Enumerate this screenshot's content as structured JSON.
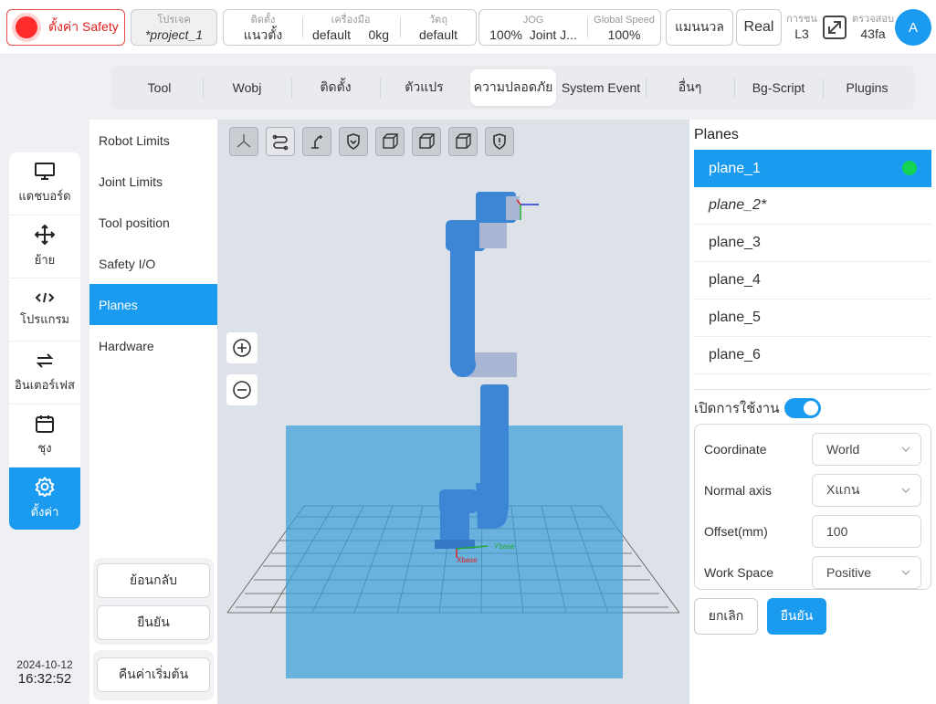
{
  "topbar": {
    "safety_label": "ตั้งค่า Safety",
    "project": {
      "label": "โปรเจค",
      "value": "*project_1"
    },
    "install": {
      "label": "ติดตั้ง",
      "value": "แนวตั้ง",
      "tool_label": "เครื่องมือ",
      "tool_value": "default",
      "weight_value": "0kg",
      "object_label": "วัตถุ",
      "object_value": "default"
    },
    "jog": {
      "label": "JOG",
      "value": "100%",
      "joint_value": "Joint J...",
      "speed_label": "Global Speed",
      "speed_value": "100%"
    },
    "manual_label": "แมนนวล",
    "real_label": "Real",
    "collision": {
      "label": "การชน",
      "value": "L3"
    },
    "check": {
      "label": "ตรวจสอบ",
      "value": "43fa"
    },
    "avatar_letter": "A"
  },
  "leftnav": {
    "items": [
      {
        "label": "แดชบอร์ด",
        "icon": "monitor-icon"
      },
      {
        "label": "ย้าย",
        "icon": "move-icon"
      },
      {
        "label": "โปรแกรม",
        "icon": "code-icon"
      },
      {
        "label": "อินเตอร์เฟส",
        "icon": "interface-icon"
      },
      {
        "label": "ชุง",
        "icon": "calendar-icon"
      },
      {
        "label": "ตั้งค่า",
        "icon": "gear-icon"
      }
    ],
    "date": "2024-10-12",
    "time": "16:32:52"
  },
  "tabs": [
    {
      "label": "Tool"
    },
    {
      "label": "Wobj"
    },
    {
      "label": "ติดตั้ง"
    },
    {
      "label": "ตัวแปร"
    },
    {
      "label": "ความปลอดภัย"
    },
    {
      "label": "System Event"
    },
    {
      "label": "อื่นๆ"
    },
    {
      "label": "Bg-Script"
    },
    {
      "label": "Plugins"
    }
  ],
  "active_tab": "ความปลอดภัย",
  "submenu": {
    "items": [
      {
        "label": "Robot Limits"
      },
      {
        "label": "Joint Limits"
      },
      {
        "label": "Tool position"
      },
      {
        "label": "Safety I/O"
      },
      {
        "label": "Planes"
      },
      {
        "label": "Hardware"
      }
    ],
    "active": "Planes",
    "back_label": "ย้อนกลับ",
    "confirm_label": "ยืนยัน",
    "reset_label": "คืนค่าเริ่มต้น"
  },
  "viewport": {
    "axis_x_label": "Xbase",
    "axis_y_label": "Ybase",
    "colors": {
      "plane": "#4aa7d9",
      "robot": "#3d86d6",
      "robot_joint": "#a9b7d4"
    }
  },
  "planes_panel": {
    "title": "Planes",
    "planes": [
      {
        "name": "plane_1",
        "active": true,
        "italic": false
      },
      {
        "name": "plane_2*",
        "active": false,
        "italic": true
      },
      {
        "name": "plane_3",
        "active": false,
        "italic": false
      },
      {
        "name": "plane_4",
        "active": false,
        "italic": false
      },
      {
        "name": "plane_5",
        "active": false,
        "italic": false
      },
      {
        "name": "plane_6",
        "active": false,
        "italic": false
      }
    ],
    "enable_label": "เปิดการใช้งาน",
    "enabled": true,
    "coordinate_label": "Coordinate",
    "coordinate_value": "World",
    "normal_axis_label": "Normal axis",
    "normal_axis_value": "Xแกน",
    "offset_label": "Offset(mm)",
    "offset_value": "100",
    "workspace_label": "Work Space",
    "workspace_value": "Positive",
    "cancel_label": "ยกเลิก",
    "confirm_label": "ยืนยัน"
  },
  "colors": {
    "accent": "#1a9bf0",
    "danger": "#e02020",
    "active_dot": "#14d456"
  }
}
